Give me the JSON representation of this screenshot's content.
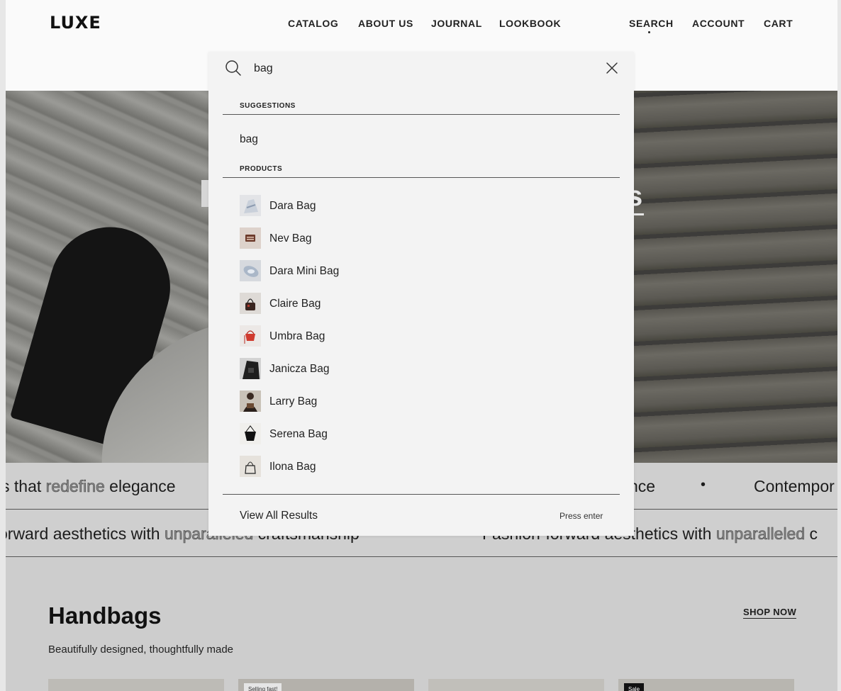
{
  "header": {
    "logo": "LUXE",
    "nav_left": [
      "CATALOG",
      "ABOUT US",
      "JOURNAL",
      "LOOKBOOK"
    ],
    "nav_right": [
      "SEARCH",
      "ACCOUNT",
      "CART"
    ],
    "active": "SEARCH"
  },
  "hero": {
    "visible_fragment_right": "s"
  },
  "search": {
    "query": "bag",
    "suggestions_label": "SUGGESTIONS",
    "suggestions": [
      "bag"
    ],
    "products_label": "PRODUCTS",
    "products": [
      {
        "name": "Dara Bag"
      },
      {
        "name": "Nev Bag"
      },
      {
        "name": "Dara Mini Bag"
      },
      {
        "name": "Claire Bag"
      },
      {
        "name": "Umbra Bag"
      },
      {
        "name": "Janicza Bag"
      },
      {
        "name": "Larry Bag"
      },
      {
        "name": "Serena Bag"
      },
      {
        "name": "Ilona Bag"
      }
    ],
    "view_all": "View All Results",
    "press_enter": "Press enter"
  },
  "marquee": {
    "row1": {
      "a_pre": "s that ",
      "a_outline": "redefine",
      "a_post": " elegance",
      "b": "nce",
      "c": "Contempor"
    },
    "row2": {
      "a_pre": "orward aesthetics with ",
      "a_outline": "unparalleled",
      "a_post": " craftsmanship",
      "b_pre": "Fashion-forward aesthetics with ",
      "b_outline": "unparalleled",
      "b_post": " c"
    }
  },
  "collection": {
    "title": "Handbags",
    "subtitle": "Beautifully designed, thoughtfully made",
    "cta": "SHOP NOW",
    "card_badges": [
      "Selling fast!",
      "Sale"
    ]
  },
  "colors": {
    "page_bg": "#fafafa",
    "panel_bg": "#f3f3f3",
    "marquee_bg": "#cfcfcf",
    "text": "#1c1c1c"
  }
}
